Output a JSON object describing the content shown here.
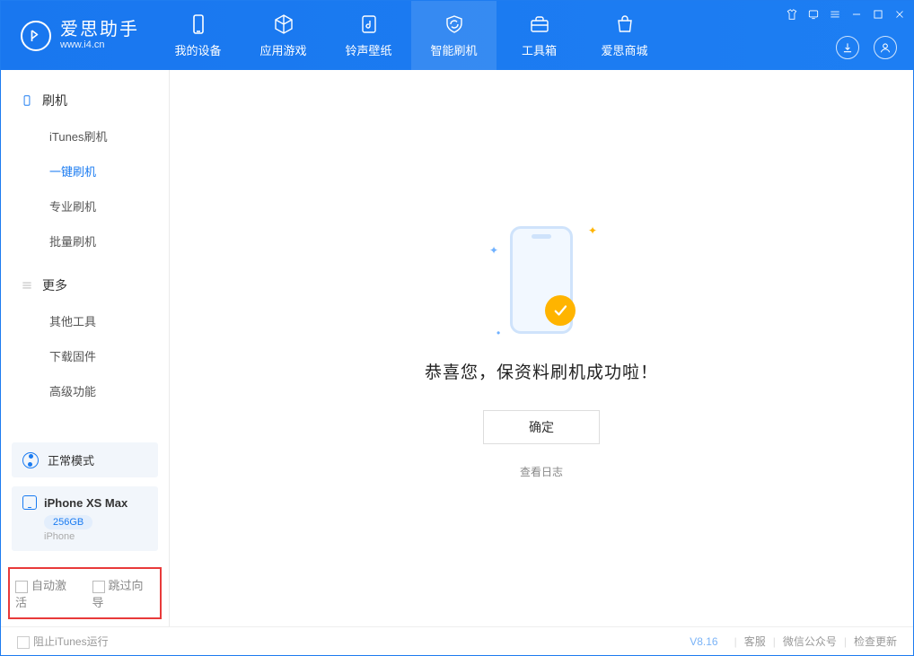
{
  "app": {
    "title": "爱思助手",
    "subtitle": "www.i4.cn"
  },
  "tabs": [
    {
      "label": "我的设备"
    },
    {
      "label": "应用游戏"
    },
    {
      "label": "铃声壁纸"
    },
    {
      "label": "智能刷机"
    },
    {
      "label": "工具箱"
    },
    {
      "label": "爱思商城"
    }
  ],
  "sidebar": {
    "group1": {
      "title": "刷机",
      "items": [
        "iTunes刷机",
        "一键刷机",
        "专业刷机",
        "批量刷机"
      ]
    },
    "group2": {
      "title": "更多",
      "items": [
        "其他工具",
        "下载固件",
        "高级功能"
      ]
    }
  },
  "mode": {
    "label": "正常模式"
  },
  "device": {
    "name": "iPhone XS Max",
    "storage": "256GB",
    "type": "iPhone"
  },
  "options": {
    "auto_activate": "自动激活",
    "skip_guide": "跳过向导"
  },
  "main": {
    "success": "恭喜您，保资料刷机成功啦！",
    "ok": "确定",
    "view_log": "查看日志"
  },
  "footer": {
    "block_itunes": "阻止iTunes运行",
    "version": "V8.16",
    "support": "客服",
    "wechat": "微信公众号",
    "update": "检查更新"
  }
}
